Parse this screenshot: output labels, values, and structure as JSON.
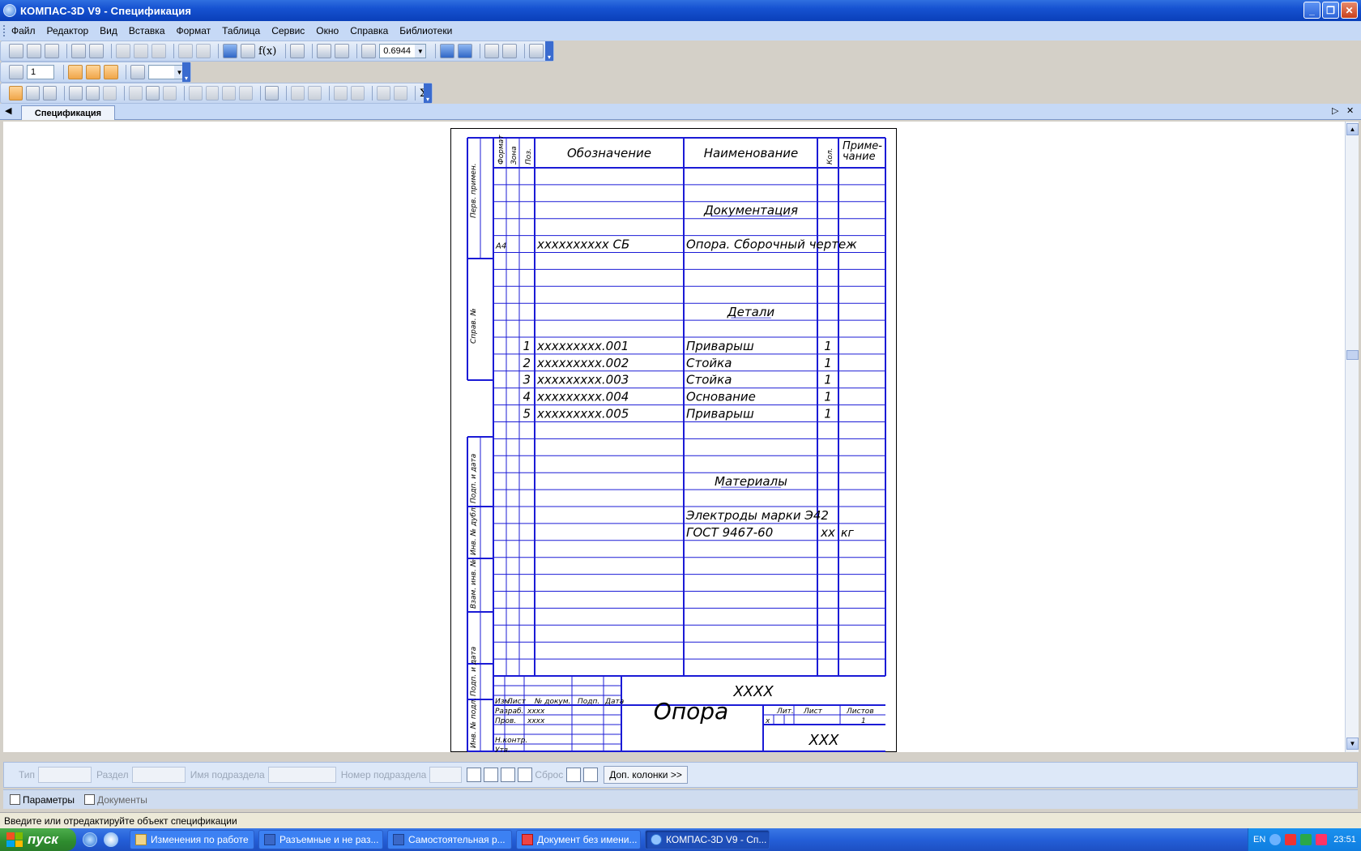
{
  "window": {
    "title": "КОМПАС-3D V9 - Спецификация",
    "minimize": "_",
    "maximize": "❐",
    "close": "✕"
  },
  "menu": [
    "Файл",
    "Редактор",
    "Вид",
    "Вставка",
    "Формат",
    "Таблица",
    "Сервис",
    "Окно",
    "Справка",
    "Библиотеки"
  ],
  "toolbar": {
    "zoom_value": "0.6944",
    "fx_label": "f(x)",
    "page_number_value": "1",
    "sigma_label": "Σ"
  },
  "document_tab": "Спецификация",
  "spec_sheet": {
    "headers": {
      "format": "Формат",
      "zone": "Зона",
      "pos": "Поз.",
      "designation": "Обозначение",
      "name": "Наименование",
      "qty": "Кол.",
      "note_line1": "Приме-",
      "note_line2": "чание"
    },
    "left_stamp": [
      "Перв. примен.",
      "Справ. №",
      "Подп. и дата",
      "Инв. № дубл.",
      "Взам. инв. №",
      "Подп. и дата",
      "Инв. № подл."
    ],
    "rows": [
      {
        "format": "",
        "pos": "",
        "designation": "",
        "name": "",
        "qty": "",
        "note": "",
        "section": false
      },
      {
        "format": "",
        "pos": "",
        "designation": "",
        "name": "",
        "qty": "",
        "note": "",
        "section": false
      },
      {
        "format": "",
        "pos": "",
        "designation": "",
        "name": "Документация",
        "qty": "",
        "note": "",
        "section": true
      },
      {
        "format": "",
        "pos": "",
        "designation": "",
        "name": "",
        "qty": "",
        "note": "",
        "section": false
      },
      {
        "format": "А4",
        "pos": "",
        "designation": "xxxxxxxxxx СБ",
        "name": "Опора. Сборочный чертеж",
        "qty": "",
        "note": "",
        "section": false
      },
      {
        "format": "",
        "pos": "",
        "designation": "",
        "name": "",
        "qty": "",
        "note": "",
        "section": false
      },
      {
        "format": "",
        "pos": "",
        "designation": "",
        "name": "",
        "qty": "",
        "note": "",
        "section": false
      },
      {
        "format": "",
        "pos": "",
        "designation": "",
        "name": "",
        "qty": "",
        "note": "",
        "section": false
      },
      {
        "format": "",
        "pos": "",
        "designation": "",
        "name": "Детали",
        "qty": "",
        "note": "",
        "section": true
      },
      {
        "format": "",
        "pos": "",
        "designation": "",
        "name": "",
        "qty": "",
        "note": "",
        "section": false
      },
      {
        "format": "",
        "pos": "1",
        "designation": "xxxxxxxxx.001",
        "name": "Приварыш",
        "qty": "1",
        "note": "",
        "section": false
      },
      {
        "format": "",
        "pos": "2",
        "designation": "xxxxxxxxx.002",
        "name": "Стойка",
        "qty": "1",
        "note": "",
        "section": false
      },
      {
        "format": "",
        "pos": "3",
        "designation": "xxxxxxxxx.003",
        "name": "Стойка",
        "qty": "1",
        "note": "",
        "section": false
      },
      {
        "format": "",
        "pos": "4",
        "designation": "xxxxxxxxx.004",
        "name": "Основание",
        "qty": "1",
        "note": "",
        "section": false
      },
      {
        "format": "",
        "pos": "5",
        "designation": "xxxxxxxxx.005",
        "name": "Приварыш",
        "qty": "1",
        "note": "",
        "section": false
      },
      {
        "format": "",
        "pos": "",
        "designation": "",
        "name": "",
        "qty": "",
        "note": "",
        "section": false
      },
      {
        "format": "",
        "pos": "",
        "designation": "",
        "name": "",
        "qty": "",
        "note": "",
        "section": false
      },
      {
        "format": "",
        "pos": "",
        "designation": "",
        "name": "",
        "qty": "",
        "note": "",
        "section": false
      },
      {
        "format": "",
        "pos": "",
        "designation": "",
        "name": "Материалы",
        "qty": "",
        "note": "",
        "section": true
      },
      {
        "format": "",
        "pos": "",
        "designation": "",
        "name": "",
        "qty": "",
        "note": "",
        "section": false
      },
      {
        "format": "",
        "pos": "",
        "designation": "",
        "name": "Электроды марки Э42",
        "qty": "",
        "note": "",
        "section": false
      },
      {
        "format": "",
        "pos": "",
        "designation": "",
        "name": "ГОСТ 9467-60",
        "qty": "хх",
        "note": "кг",
        "section": false
      },
      {
        "format": "",
        "pos": "",
        "designation": "",
        "name": "",
        "qty": "",
        "note": "",
        "section": false
      },
      {
        "format": "",
        "pos": "",
        "designation": "",
        "name": "",
        "qty": "",
        "note": "",
        "section": false
      },
      {
        "format": "",
        "pos": "",
        "designation": "",
        "name": "",
        "qty": "",
        "note": "",
        "section": false
      },
      {
        "format": "",
        "pos": "",
        "designation": "",
        "name": "",
        "qty": "",
        "note": "",
        "section": false
      },
      {
        "format": "",
        "pos": "",
        "designation": "",
        "name": "",
        "qty": "",
        "note": "",
        "section": false
      },
      {
        "format": "",
        "pos": "",
        "designation": "",
        "name": "",
        "qty": "",
        "note": "",
        "section": false
      },
      {
        "format": "",
        "pos": "",
        "designation": "",
        "name": "",
        "qty": "",
        "note": "",
        "section": false
      },
      {
        "format": "",
        "pos": "",
        "designation": "",
        "name": "",
        "qty": "",
        "note": "",
        "section": false
      }
    ],
    "title_block": {
      "doc_code": "ХХХХ",
      "doc_name": "Опора",
      "org": "ХХХ",
      "col_headers": [
        "Изм.",
        "Лист",
        "№ докум.",
        "Подп.",
        "Дата"
      ],
      "roles": [
        "Разраб.",
        "Пров.",
        "",
        "Н.контр.",
        "Утв."
      ],
      "names": [
        "хххх",
        "хххх",
        "",
        "",
        ""
      ],
      "lit_label": "Лит.",
      "sheet_label": "Лист",
      "sheets_label": "Листов",
      "lit_value": "х",
      "sheets_value": "1"
    }
  },
  "spec_panel": {
    "type_label": "Тип",
    "section_label": "Раздел",
    "section_name_label": "Имя подраздела",
    "section_number_label": "Номер подраздела",
    "reset_label": "Сброс",
    "extra_columns_label": "Доп. колонки  >>"
  },
  "panel_tabs": [
    "Параметры",
    "Документы"
  ],
  "status_text": "Введите или отредактируйте объект спецификации",
  "taskbar": {
    "start_label": "пуск",
    "tasks": [
      "Изменения по работе",
      "Разъемные и не раз...",
      "Самостоятельная р...",
      "Документ без имени...",
      "КОМПАС-3D V9 - Сп..."
    ],
    "lang": "EN",
    "clock": "23:51"
  }
}
